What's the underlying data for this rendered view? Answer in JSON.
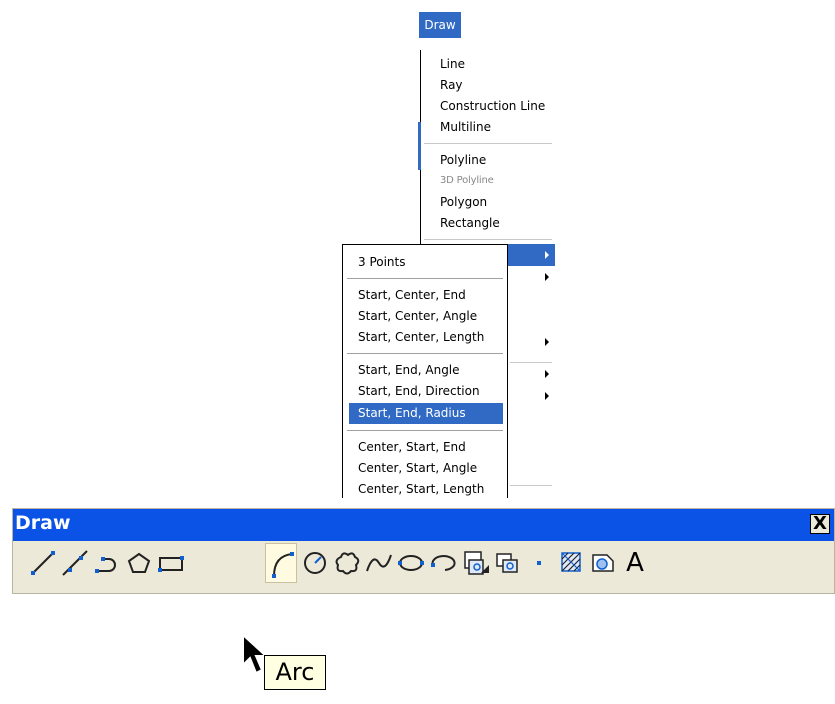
{
  "menu": {
    "title": "Draw",
    "items": [
      "Line",
      "Ray",
      "Construction Line",
      "Multiline",
      "Polyline",
      "3D Polyline",
      "Polygon",
      "Rectangle"
    ]
  },
  "arc_submenu": {
    "items": [
      "3 Points",
      "Start, Center, End",
      "Start, Center, Angle",
      "Start, Center, Length",
      "Start, End, Angle",
      "Start, End, Direction",
      "Start, End, Radius",
      "Center, Start, End",
      "Center, Start, Angle",
      "Center, Start, Length"
    ],
    "highlighted": "Start, End, Radius"
  },
  "toolbar": {
    "title": "Draw",
    "close_label": "X",
    "tools": [
      "line-icon",
      "construction-line-icon",
      "polyline-icon",
      "polygon-icon",
      "rectangle-icon",
      "arc-icon",
      "circle-icon",
      "revision-cloud-icon",
      "spline-icon",
      "ellipse-icon",
      "ellipse-arc-icon",
      "insert-block-icon",
      "make-block-icon",
      "point-icon",
      "hatch-icon",
      "region-icon",
      "multiline-text-icon"
    ],
    "text_tool_glyph": "A",
    "active_tool": "arc-icon"
  },
  "tooltip": {
    "text": "Arc"
  },
  "colors": {
    "highlight": "#316ac5",
    "titlebar": "#0a53e6",
    "toolbar_bg": "#ece9d8",
    "tooltip_bg": "#ffffe1",
    "icon_blue": "#1060d0"
  }
}
